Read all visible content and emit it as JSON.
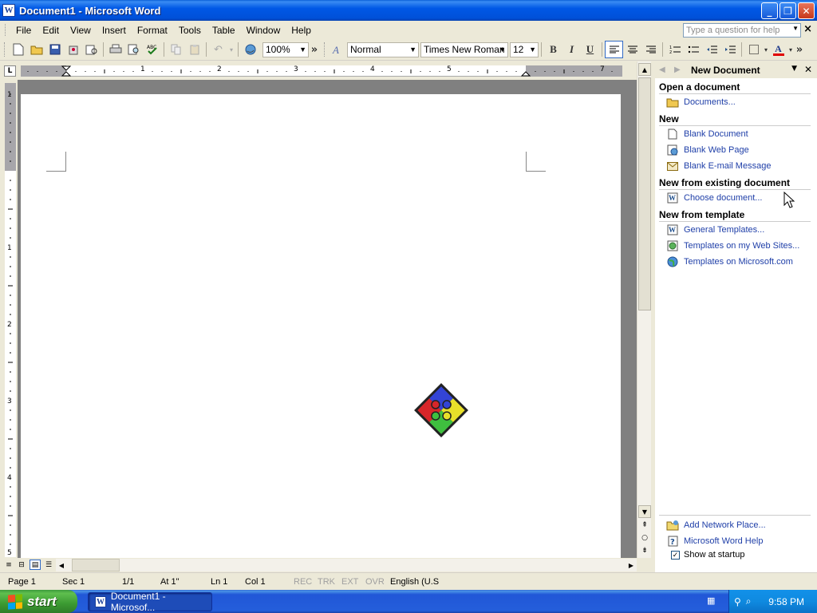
{
  "window": {
    "title": "Document1 - Microsoft Word",
    "app_icon": "W",
    "buttons": {
      "minimize": "_",
      "maximize": "❐",
      "close": "✕"
    }
  },
  "menubar": {
    "items": [
      "File",
      "Edit",
      "View",
      "Insert",
      "Format",
      "Tools",
      "Table",
      "Window",
      "Help"
    ],
    "help_placeholder": "Type a question for help",
    "mdi_close": "×"
  },
  "toolbar": {
    "zoom": "100%",
    "style": "Normal",
    "font": "Times New Roman",
    "size": "12",
    "bold": "B",
    "italic": "I",
    "underline": "U",
    "overflow": "»",
    "font_color_glyph": "A"
  },
  "ruler": {
    "corner": "L",
    "h_numbers": [
      "1",
      "2",
      "3",
      "4",
      "5",
      "7"
    ],
    "v_numbers": [
      "1",
      "1",
      "2",
      "3",
      "4",
      "5"
    ]
  },
  "task_pane": {
    "title": "New Document",
    "sections": [
      {
        "heading": "Open a document",
        "links": [
          {
            "label": "Documents...",
            "icon": "folder-open-icon"
          }
        ]
      },
      {
        "heading": "New",
        "links": [
          {
            "label": "Blank Document",
            "icon": "blank-document-icon"
          },
          {
            "label": "Blank Web Page",
            "icon": "web-page-icon"
          },
          {
            "label": "Blank E-mail Message",
            "icon": "email-icon"
          }
        ]
      },
      {
        "heading": "New from existing document",
        "links": [
          {
            "label": "Choose document...",
            "icon": "word-document-icon"
          }
        ]
      },
      {
        "heading": "New from template",
        "links": [
          {
            "label": "General Templates...",
            "icon": "word-document-icon"
          },
          {
            "label": "Templates on my Web Sites...",
            "icon": "web-template-icon"
          },
          {
            "label": "Templates on Microsoft.com",
            "icon": "globe-icon"
          }
        ]
      }
    ],
    "bottom_links": [
      {
        "label": "Add Network Place...",
        "icon": "network-folder-icon"
      },
      {
        "label": "Microsoft Word Help",
        "icon": "help-icon"
      }
    ],
    "show_at_startup": "Show at startup",
    "show_at_startup_checked": true
  },
  "statusbar": {
    "page": "Page 1",
    "sec": "Sec 1",
    "pages": "1/1",
    "at": "At 1\"",
    "ln": "Ln 1",
    "col": "Col 1",
    "rec": "REC",
    "trk": "TRK",
    "ext": "EXT",
    "ovr": "OVR",
    "language": "English (U.S"
  },
  "taskbar": {
    "start": "start",
    "task_button": "Document1 - Microsof...",
    "clock": "9:58 PM"
  },
  "colors": {
    "titlebar": "#0058e6",
    "link": "#1f3fa8",
    "start_green": "#3b9a32",
    "font_color_red": "#e00000"
  }
}
